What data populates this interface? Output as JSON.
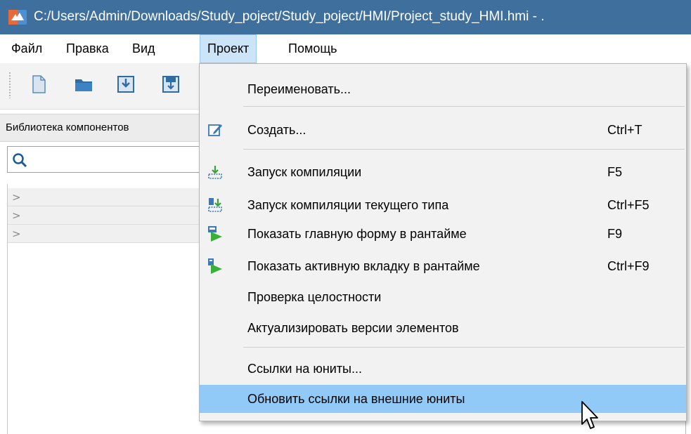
{
  "window": {
    "title": "C:/Users/Admin/Downloads/Study_poject/Study_poject/HMI/Project_study_HMI.hmi - ."
  },
  "menubar": {
    "items": [
      {
        "label": "Файл",
        "active": false
      },
      {
        "label": "Правка",
        "active": false
      },
      {
        "label": "Вид",
        "active": false
      },
      {
        "label": "Проект",
        "active": true
      },
      {
        "label": "Помощь",
        "active": false
      }
    ]
  },
  "toolbar": {
    "buttons": [
      "new-file-icon",
      "open-folder-icon",
      "import-icon",
      "save-icon"
    ]
  },
  "left_panel": {
    "title": "Библиотека компонентов",
    "search_icon": "search-icon",
    "tree_rows": [
      ">",
      ">",
      ">"
    ]
  },
  "project_menu": {
    "items": [
      {
        "label": "Переименовать...",
        "shortcut": "",
        "icon": ""
      },
      {
        "label": "Создать...",
        "shortcut": "Ctrl+T",
        "icon": "edit-icon"
      },
      {
        "label": "Запуск компиляции",
        "shortcut": "F5",
        "icon": "compile-icon"
      },
      {
        "label": "Запуск компиляции текущего типа",
        "shortcut": "Ctrl+F5",
        "icon": "compile-type-icon"
      },
      {
        "label": "Показать главную форму в рантайме",
        "shortcut": "F9",
        "icon": "run-form-icon"
      },
      {
        "label": "Показать активную вкладку в рантайме",
        "shortcut": "Ctrl+F9",
        "icon": "run-tab-icon"
      },
      {
        "label": "Проверка целостности",
        "shortcut": "",
        "icon": ""
      },
      {
        "label": "Актуализировать версии элементов",
        "shortcut": "",
        "icon": ""
      },
      {
        "label": "Ссылки на юниты...",
        "shortcut": "",
        "icon": ""
      },
      {
        "label": "Обновить ссылки на внешние юниты",
        "shortcut": "",
        "icon": "",
        "highlighted": true
      }
    ]
  },
  "colors": {
    "titlebar": "#3f6f9c",
    "menu_active": "#cce4f7",
    "highlight": "#91c9f7",
    "menu_bg": "#f2f2f2"
  }
}
